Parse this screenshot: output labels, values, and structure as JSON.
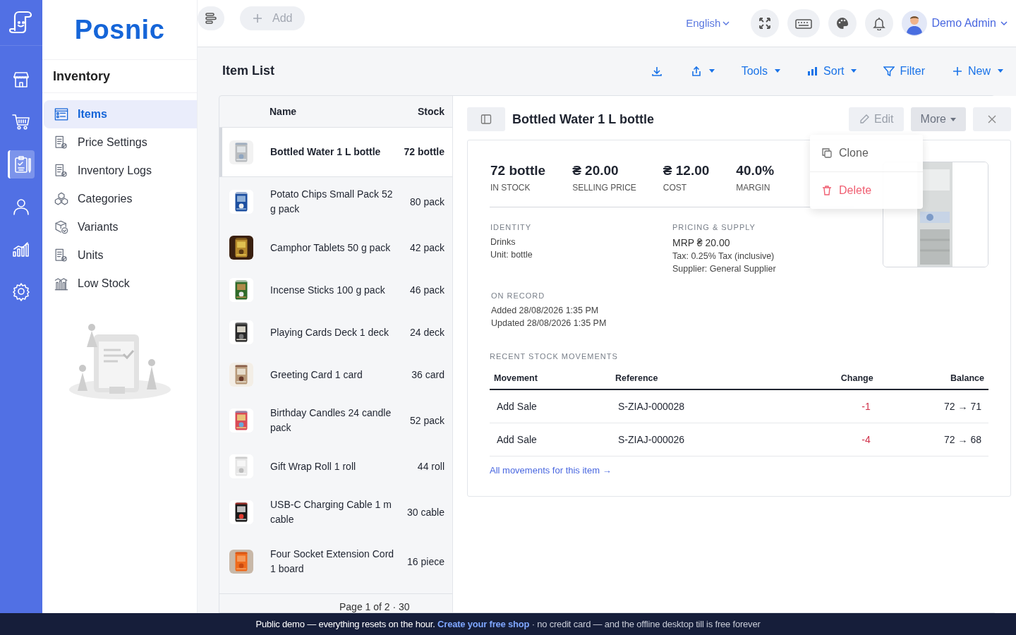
{
  "rail": {
    "items": [
      {
        "selected": false
      },
      {
        "selected": false
      },
      {
        "selected": true
      },
      {
        "selected": false
      },
      {
        "selected": false
      },
      {
        "selected": false
      }
    ]
  },
  "sidebar": {
    "logo": "Posnic",
    "heading": "Inventory",
    "items": [
      {
        "label": "Items",
        "selected": true
      },
      {
        "label": "Price Settings",
        "selected": false
      },
      {
        "label": "Inventory Logs",
        "selected": false
      },
      {
        "label": "Categories",
        "selected": false
      },
      {
        "label": "Variants",
        "selected": false
      },
      {
        "label": "Units",
        "selected": false
      },
      {
        "label": "Low Stock",
        "selected": false
      }
    ]
  },
  "topbar": {
    "add_button": "Add",
    "language": "English",
    "user": "Demo Admin"
  },
  "page": {
    "title": "Item List",
    "actions": [
      "Tools",
      "Sort",
      "Filter",
      "New"
    ]
  },
  "list": {
    "columns": [
      "Name",
      "Stock"
    ],
    "rows": [
      {
        "name": "Bottled Water 1 L bottle",
        "stock": "72 bottle",
        "selected": true
      },
      {
        "name": "Potato Chips Small Pack 52 g pack",
        "stock": "80 pack",
        "selected": false
      },
      {
        "name": "Camphor Tablets 50 g pack",
        "stock": "42 pack",
        "selected": false
      },
      {
        "name": "Incense Sticks 100 g pack",
        "stock": "46 pack",
        "selected": false
      },
      {
        "name": "Playing Cards Deck 1 deck",
        "stock": "24 deck",
        "selected": false
      },
      {
        "name": "Greeting Card 1 card",
        "stock": "36 card",
        "selected": false
      },
      {
        "name": "Birthday Candles 24 candle pack",
        "stock": "52 pack",
        "selected": false
      },
      {
        "name": "Gift Wrap Roll 1 roll",
        "stock": "44 roll",
        "selected": false
      },
      {
        "name": "USB-C Charging Cable 1 m cable",
        "stock": "30 cable",
        "selected": false
      },
      {
        "name": "Four Socket Extension Cord 1 board",
        "stock": "16 piece",
        "selected": false
      }
    ],
    "pagination": "Page 1 of 2 · 30"
  },
  "detail": {
    "title": "Bottled Water 1 L bottle",
    "edit": "Edit",
    "more": "More",
    "menu": [
      {
        "label": "Clone",
        "kind": "normal"
      },
      {
        "label": "Delete",
        "kind": "danger"
      }
    ],
    "stats": [
      {
        "value": "72 bottle",
        "label": "IN STOCK"
      },
      {
        "value": "₴ 20.00",
        "label": "SELLING PRICE"
      },
      {
        "value": "₴ 12.00",
        "label": "COST"
      },
      {
        "value": "40.0%",
        "label": "MARGIN"
      }
    ],
    "sections": [
      {
        "heading": "IDENTITY",
        "lines": [
          "Drinks",
          "Unit: bottle"
        ]
      },
      {
        "heading": "PRICING & SUPPLY",
        "lines": [
          "MRP ₴ 20.00",
          "Tax: 0.25% Tax (inclusive)",
          "Supplier: General Supplier"
        ]
      }
    ],
    "record": {
      "heading": "ON RECORD",
      "lines": [
        "Added 28/08/2026 1:35 PM",
        "Updated 28/08/2026 1:35 PM"
      ]
    },
    "movements": {
      "heading": "RECENT STOCK MOVEMENTS",
      "columns": [
        "Movement",
        "Reference",
        "Change",
        "Balance"
      ],
      "rows": [
        [
          "Add Sale",
          "S-ZIAJ-000028",
          "-1",
          "72 → 71"
        ],
        [
          "Add Sale",
          "S-ZIAJ-000026",
          "-4",
          "72 → 68"
        ]
      ],
      "link": "All movements for this item →"
    }
  },
  "banner": {
    "text": "Public demo — everything resets on the hour.",
    "link": "Create your free shop",
    "rest": "· no credit card — and the offline desktop till is free forever"
  }
}
